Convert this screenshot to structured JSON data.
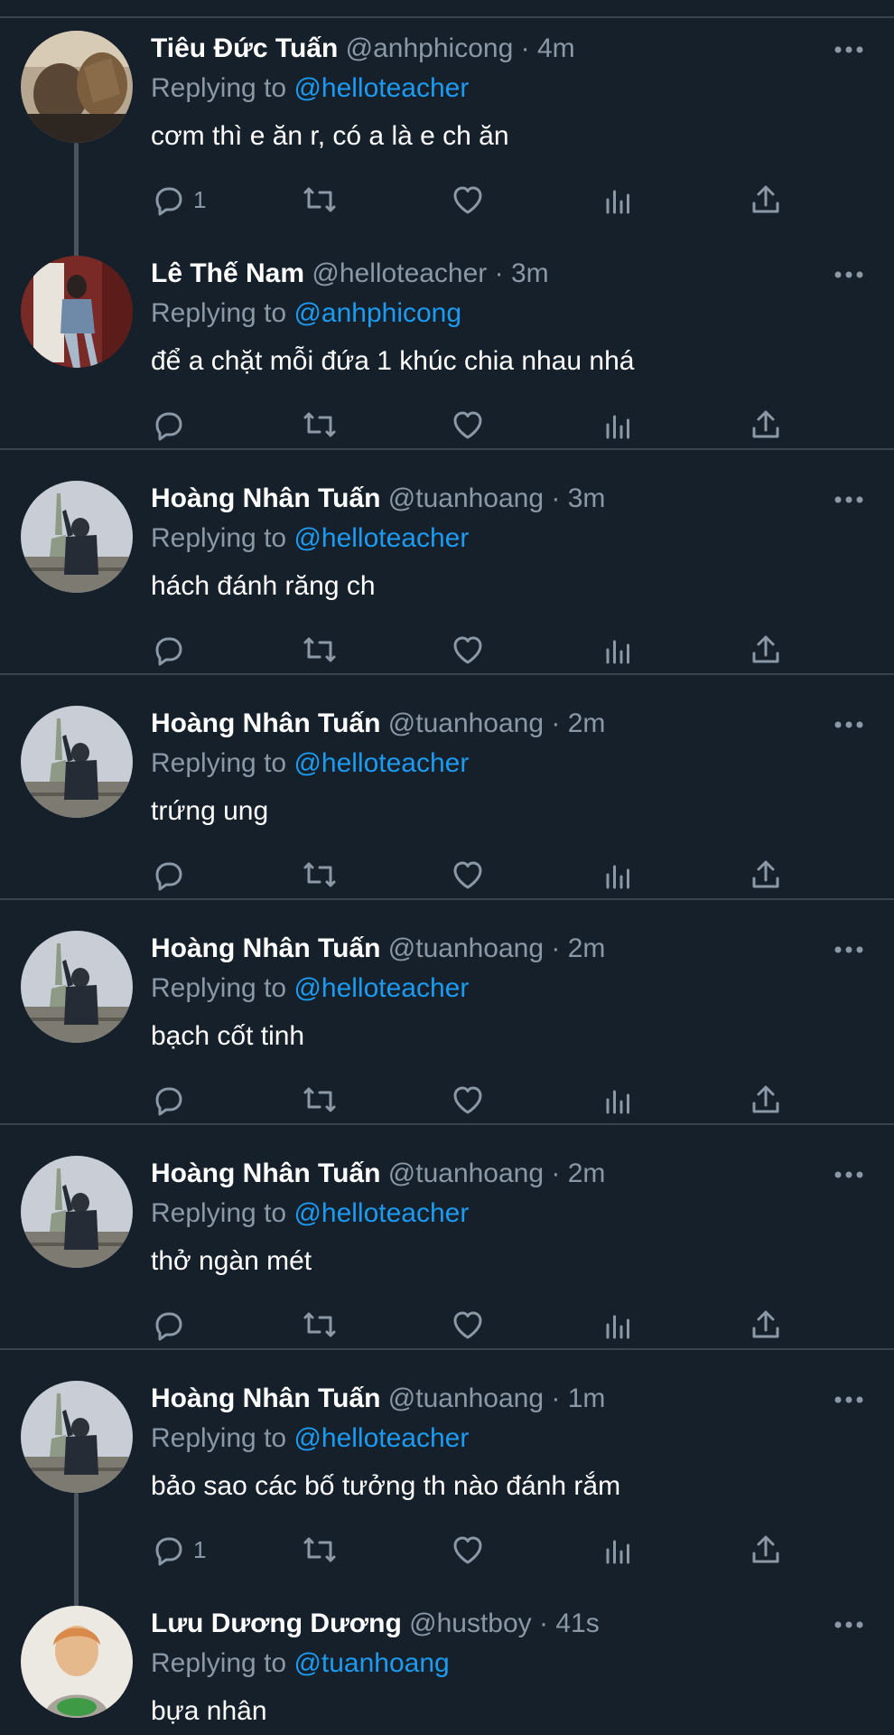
{
  "reply_prefix": "Replying to",
  "separator": "·",
  "colors": {
    "background": "#15202b",
    "divider": "#38444d",
    "secondary_text": "#8b98a5",
    "link": "#1d9bf0"
  },
  "icons": [
    "reply-icon",
    "retweet-icon",
    "like-icon",
    "views-icon",
    "share-icon",
    "more-icon"
  ],
  "tweets": [
    {
      "name": "Tiêu Đức Tuấn",
      "handle": "@anhphicong",
      "time": "4m",
      "replying_to": "@helloteacher",
      "text": "cơm thì e ăn r, có a là e ch ăn",
      "reply_count": "1",
      "avatar_icon": "avatar-photo-icon"
    },
    {
      "name": "Lê Thế Nam",
      "handle": "@helloteacher",
      "time": "3m",
      "replying_to": "@anhphicong",
      "text": "để a chặt mỗi đứa 1 khúc chia nhau nhá",
      "reply_count": "",
      "avatar_icon": "avatar-photo-icon"
    },
    {
      "name": "Hoàng Nhân Tuấn",
      "handle": "@tuanhoang",
      "time": "3m",
      "replying_to": "@helloteacher",
      "text": "hách đánh răng ch",
      "reply_count": "",
      "avatar_icon": "avatar-photo-icon"
    },
    {
      "name": "Hoàng Nhân Tuấn",
      "handle": "@tuanhoang",
      "time": "2m",
      "replying_to": "@helloteacher",
      "text": "trứng ung",
      "reply_count": "",
      "avatar_icon": "avatar-photo-icon"
    },
    {
      "name": "Hoàng Nhân Tuấn",
      "handle": "@tuanhoang",
      "time": "2m",
      "replying_to": "@helloteacher",
      "text": "bạch cốt tinh",
      "reply_count": "",
      "avatar_icon": "avatar-photo-icon"
    },
    {
      "name": "Hoàng Nhân Tuấn",
      "handle": "@tuanhoang",
      "time": "2m",
      "replying_to": "@helloteacher",
      "text": "thở ngàn mét",
      "reply_count": "",
      "avatar_icon": "avatar-photo-icon"
    },
    {
      "name": "Hoàng Nhân Tuấn",
      "handle": "@tuanhoang",
      "time": "1m",
      "replying_to": "@helloteacher",
      "text": "bảo sao các bố tưởng th nào đánh rắm",
      "reply_count": "1",
      "avatar_icon": "avatar-photo-icon"
    },
    {
      "name": "Lưu Dương Dương",
      "handle": "@hustboy",
      "time": "41s",
      "replying_to": "@tuanhoang",
      "text": "bựa nhân",
      "reply_count": "",
      "avatar_icon": "avatar-photo-icon"
    }
  ]
}
